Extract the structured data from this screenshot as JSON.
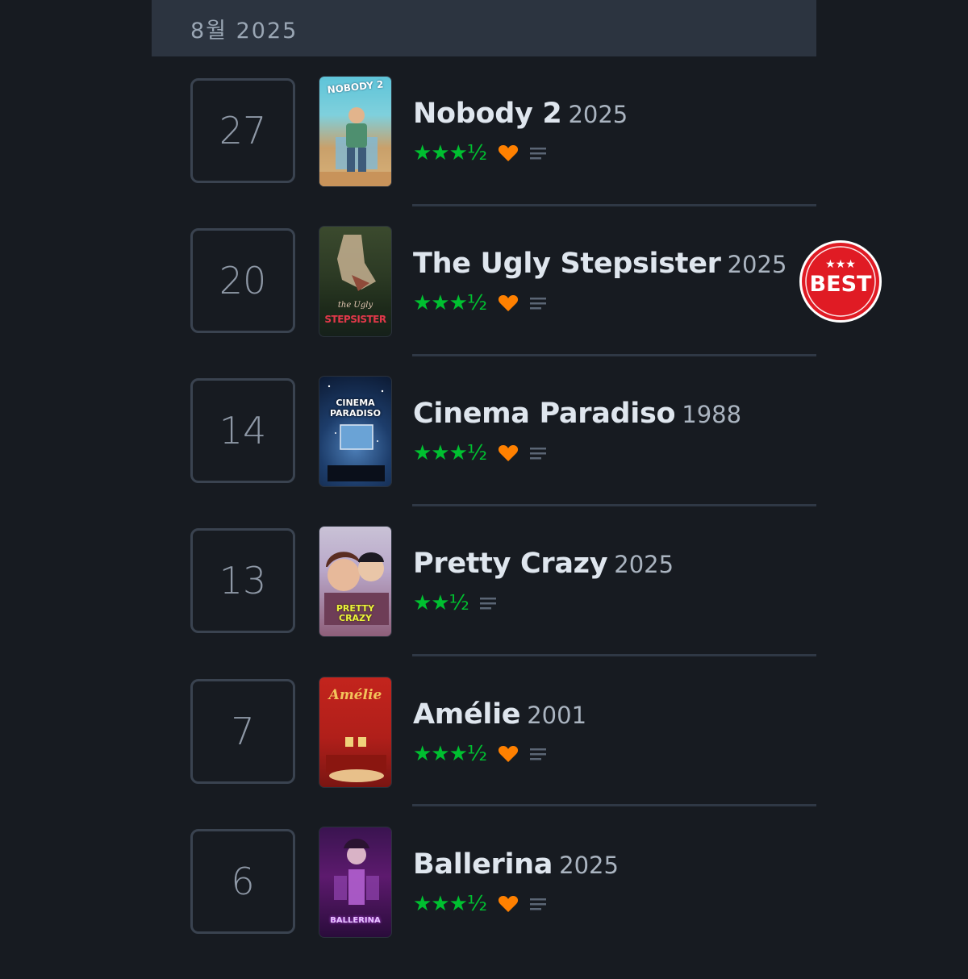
{
  "month_header": "8월 2025",
  "entries": [
    {
      "day": "27",
      "title": "Nobody 2",
      "year": "2025",
      "stars": "★★★½",
      "liked": true,
      "poster_text": "NOBODY 2"
    },
    {
      "day": "20",
      "title": "The Ugly Stepsister",
      "year": "2025",
      "stars": "★★★½",
      "liked": true,
      "poster_text": "STEPSISTER",
      "poster_script": "the Ugly"
    },
    {
      "day": "14",
      "title": "Cinema Paradiso",
      "year": "1988",
      "stars": "★★★½",
      "liked": true,
      "poster_text": "CINEMA PARADISO"
    },
    {
      "day": "13",
      "title": "Pretty Crazy",
      "year": "2025",
      "stars": "★★½",
      "liked": false,
      "poster_text": "PRETTY CRAZY"
    },
    {
      "day": "7",
      "title": "Amélie",
      "year": "2001",
      "stars": "★★★½",
      "liked": true,
      "poster_text": "Amélie"
    },
    {
      "day": "6",
      "title": "Ballerina",
      "year": "2025",
      "stars": "★★★½",
      "liked": true,
      "poster_text": "BALLERINA"
    }
  ],
  "badge": {
    "label": "BEST",
    "stars": "★★★"
  },
  "colors": {
    "background": "#171b21",
    "header": "#2c3440",
    "star_green": "#00c030",
    "heart_orange": "#ff8000",
    "badge_red": "#e01b24"
  },
  "icons": {
    "heart": "heart-icon",
    "review": "review-lines-icon",
    "badge": "best-badge-icon"
  }
}
